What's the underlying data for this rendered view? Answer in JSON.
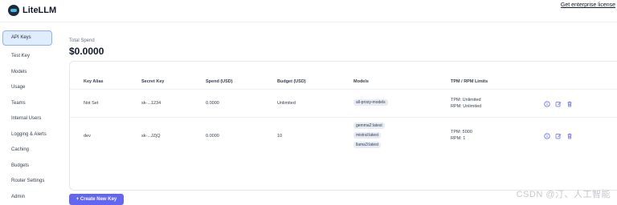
{
  "app": {
    "name": "LiteLLM",
    "enterprise_link": "Get enterprise license"
  },
  "sidebar": {
    "items": [
      {
        "label": "API Keys",
        "active": true
      },
      {
        "label": "Test Key"
      },
      {
        "label": "Models"
      },
      {
        "label": "Usage"
      },
      {
        "label": "Teams"
      },
      {
        "label": "Internal Users"
      },
      {
        "label": "Logging & Alerts"
      },
      {
        "label": "Caching"
      },
      {
        "label": "Budgets"
      },
      {
        "label": "Router Settings"
      },
      {
        "label": "Admin"
      }
    ]
  },
  "spend": {
    "label": "Total Spend",
    "value": "$0.0000"
  },
  "table": {
    "headers": [
      "Key Alias",
      "Secret Key",
      "Spend (USD)",
      "Budget (USD)",
      "Models",
      "TPM / RPM Limits"
    ],
    "rows": [
      {
        "alias": "Not Set",
        "secret": "sk-...1234",
        "spend": "0.0000",
        "budget": "Unlimited",
        "models": [
          "all-proxy-models"
        ],
        "tpm": "TPM: Unlimited",
        "rpm": "RPM: Unlimited"
      },
      {
        "alias": "dev",
        "secret": "sk-...JZjQ",
        "spend": "0.0000",
        "budget": "10",
        "models": [
          "gemma2:latest",
          "mistral:latest",
          "llama3:latest"
        ],
        "tpm": "TPM: 5000",
        "rpm": "RPM: 1"
      }
    ],
    "row_actions": [
      "info-icon",
      "edit-icon",
      "trash-icon"
    ]
  },
  "create_button": "+ Create New Key",
  "watermark": "CSDN @汀、人工智能",
  "colors": {
    "accent": "#6366f1",
    "active_nav_bg": "#e0ecff",
    "active_nav_border": "#8ab4f8",
    "pill_bg": "#e6ebf5"
  }
}
